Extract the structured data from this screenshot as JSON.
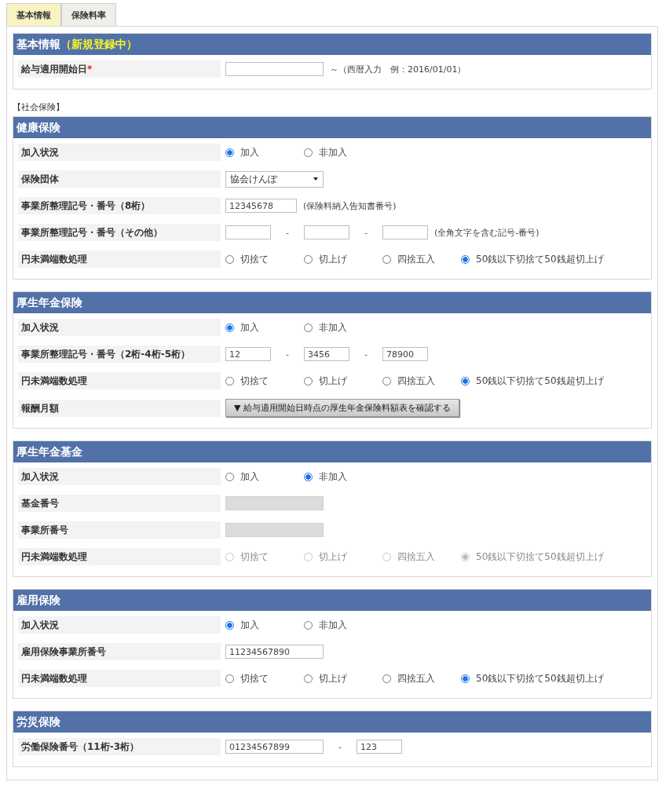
{
  "tabs": [
    {
      "label": "基本情報",
      "selected": true
    },
    {
      "label": "保険料率",
      "selected": false
    }
  ],
  "sections": [
    {
      "title": "基本情報",
      "status": "（新規登録中）",
      "rows": [
        {
          "label": "給与適用開始日",
          "required_mark": "*",
          "parts": [
            {
              "kind": "long_field",
              "disabled": false
            },
            {
              "kind": "note",
              "text": "～（西暦入力　例：2016/01/01）"
            }
          ]
        }
      ]
    },
    {
      "caption": "【社会保険】",
      "title": "健康保険",
      "rows": [
        {
          "label": "加入状況",
          "parts": [
            {
              "kind": "radio",
              "label": "加入",
              "selected": true,
              "disabled": false
            },
            {
              "kind": "radio",
              "label": "非加入",
              "selected": false,
              "disabled": false
            }
          ]
        },
        {
          "label": "保険団体",
          "parts": [
            {
              "kind": "select",
              "value": "協会けんぽ"
            }
          ]
        },
        {
          "label": "事業所整理記号・番号（8桁）",
          "parts": [
            {
              "kind": "mid_field",
              "value": "12345678",
              "disabled": false
            },
            {
              "kind": "note",
              "text": "(保険料納入告知書番号)"
            }
          ]
        },
        {
          "label": "事業所整理記号・番号（その他）",
          "parts": [
            {
              "kind": "short_field",
              "disabled": false
            },
            {
              "kind": "sep",
              "text": "-"
            },
            {
              "kind": "short_field",
              "disabled": false
            },
            {
              "kind": "sep",
              "text": "-"
            },
            {
              "kind": "short_field",
              "disabled": false
            },
            {
              "kind": "note",
              "text": "(全角文字を含む記号-番号)"
            }
          ]
        },
        {
          "label": "円未満端数処理",
          "parts": [
            {
              "kind": "radio",
              "label": "切捨て",
              "selected": false,
              "disabled": false
            },
            {
              "kind": "radio",
              "label": "切上げ",
              "selected": false,
              "disabled": false
            },
            {
              "kind": "radio",
              "label": "四捨五入",
              "selected": false,
              "disabled": false
            },
            {
              "kind": "radio",
              "label": "50銭以下切捨て50銭超切上げ",
              "selected": true,
              "disabled": false
            }
          ]
        }
      ]
    },
    {
      "title": "厚生年金保険",
      "rows": [
        {
          "label": "加入状況",
          "parts": [
            {
              "kind": "radio",
              "label": "加入",
              "selected": true,
              "disabled": false
            },
            {
              "kind": "radio",
              "label": "非加入",
              "selected": false,
              "disabled": false
            }
          ]
        },
        {
          "label": "事業所整理記号・番号（2桁-4桁-5桁）",
          "parts": [
            {
              "kind": "short_field",
              "value": "12",
              "disabled": false
            },
            {
              "kind": "sep",
              "text": "-"
            },
            {
              "kind": "short_field",
              "value": "3456",
              "disabled": false
            },
            {
              "kind": "sep",
              "text": "-"
            },
            {
              "kind": "short_field",
              "value": "78900",
              "disabled": false
            }
          ]
        },
        {
          "label": "円未満端数処理",
          "parts": [
            {
              "kind": "radio",
              "label": "切捨て",
              "selected": false,
              "disabled": false
            },
            {
              "kind": "radio",
              "label": "切上げ",
              "selected": false,
              "disabled": false
            },
            {
              "kind": "radio",
              "label": "四捨五入",
              "selected": false,
              "disabled": false
            },
            {
              "kind": "radio",
              "label": "50銭以下切捨て50銭超切上げ",
              "selected": true,
              "disabled": false
            }
          ]
        },
        {
          "label": "報酬月額",
          "parts": [
            {
              "kind": "button",
              "label": "▼ 給与適用開始日時点の厚生年金保険料額表を確認する"
            }
          ]
        }
      ]
    },
    {
      "title": "厚生年金基金",
      "rows": [
        {
          "label": "加入状況",
          "parts": [
            {
              "kind": "radio",
              "label": "加入",
              "selected": false,
              "disabled": false
            },
            {
              "kind": "radio",
              "label": "非加入",
              "selected": true,
              "disabled": false
            }
          ]
        },
        {
          "label": "基金番号",
          "parts": [
            {
              "kind": "long_field",
              "disabled": true
            }
          ]
        },
        {
          "label": "事業所番号",
          "parts": [
            {
              "kind": "long_field",
              "disabled": true
            }
          ]
        },
        {
          "label": "円未満端数処理",
          "parts": [
            {
              "kind": "radio",
              "label": "切捨て",
              "selected": false,
              "disabled": true
            },
            {
              "kind": "radio",
              "label": "切上げ",
              "selected": false,
              "disabled": true
            },
            {
              "kind": "radio",
              "label": "四捨五入",
              "selected": false,
              "disabled": true
            },
            {
              "kind": "radio",
              "label": "50銭以下切捨て50銭超切上げ",
              "selected": true,
              "disabled": true
            }
          ]
        }
      ]
    },
    {
      "title": "雇用保険",
      "rows": [
        {
          "label": "加入状況",
          "parts": [
            {
              "kind": "radio",
              "label": "加入",
              "selected": true,
              "disabled": false
            },
            {
              "kind": "radio",
              "label": "非加入",
              "selected": false,
              "disabled": false
            }
          ]
        },
        {
          "label": "雇用保険事業所番号",
          "parts": [
            {
              "kind": "long_field",
              "value": "11234567890",
              "disabled": false
            }
          ]
        },
        {
          "label": "円未満端数処理",
          "parts": [
            {
              "kind": "radio",
              "label": "切捨て",
              "selected": false,
              "disabled": false
            },
            {
              "kind": "radio",
              "label": "切上げ",
              "selected": false,
              "disabled": false
            },
            {
              "kind": "radio",
              "label": "四捨五入",
              "selected": false,
              "disabled": false
            },
            {
              "kind": "radio",
              "label": "50銭以下切捨て50銭超切上げ",
              "selected": true,
              "disabled": false
            }
          ]
        }
      ]
    },
    {
      "title": "労災保険",
      "rows": [
        {
          "label": "労働保険番号（11桁-3桁）",
          "parts": [
            {
              "kind": "long_field",
              "value": "01234567899",
              "disabled": false
            },
            {
              "kind": "sep",
              "text": "-"
            },
            {
              "kind": "short_field",
              "value": "123",
              "disabled": false
            }
          ]
        }
      ]
    }
  ]
}
